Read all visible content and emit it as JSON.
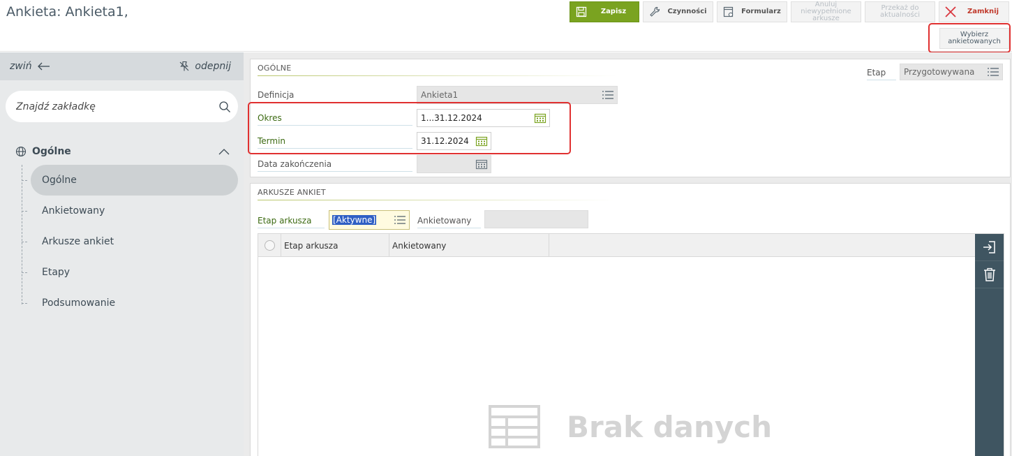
{
  "header": {
    "title": "Ankieta: Ankieta1,",
    "toolbar": {
      "save": "Zapisz",
      "actions": "Czynności",
      "form": "Formularz",
      "cancel_line1": "Anuluj",
      "cancel_line2": "niewypełnione",
      "cancel_line3": "arkusze",
      "forward_line1": "Przekaż do",
      "forward_line2": "aktualności",
      "close": "Zamknij",
      "select_line1": "Wybierz",
      "select_line2": "ankietowanych"
    }
  },
  "sidebar": {
    "collapse_label": "zwiń",
    "unpin_label": "odepnij",
    "search_placeholder": "Znajdź zakładkę",
    "group_label": "Ogólne",
    "items": [
      {
        "label": "Ogólne"
      },
      {
        "label": "Ankietowany"
      },
      {
        "label": "Arkusze ankiet"
      },
      {
        "label": "Etapy"
      },
      {
        "label": "Podsumowanie"
      }
    ]
  },
  "general": {
    "section_title": "OGÓLNE",
    "definition_label": "Definicja",
    "definition_value": "Ankieta1",
    "period_label": "Okres",
    "period_value": "1...31.12.2024",
    "deadline_label": "Termin",
    "deadline_value": "31.12.2024",
    "end_date_label": "Data zakończenia",
    "end_date_value": "",
    "stage_label": "Etap",
    "stage_value": "Przygotowywana"
  },
  "sheets": {
    "section_title": "ARKUSZE ANKIET",
    "filter_stage_label": "Etap arkusza",
    "filter_stage_value": "[Aktywne]",
    "filter_respondent_label": "Ankietowany",
    "filter_respondent_value": "",
    "columns": [
      "Etap arkusza",
      "Ankietowany"
    ],
    "empty_text": "Brak danych"
  },
  "colors": {
    "accent_green": "#7aa320",
    "highlight_red": "#e03030",
    "side_panel": "#3f5561"
  }
}
